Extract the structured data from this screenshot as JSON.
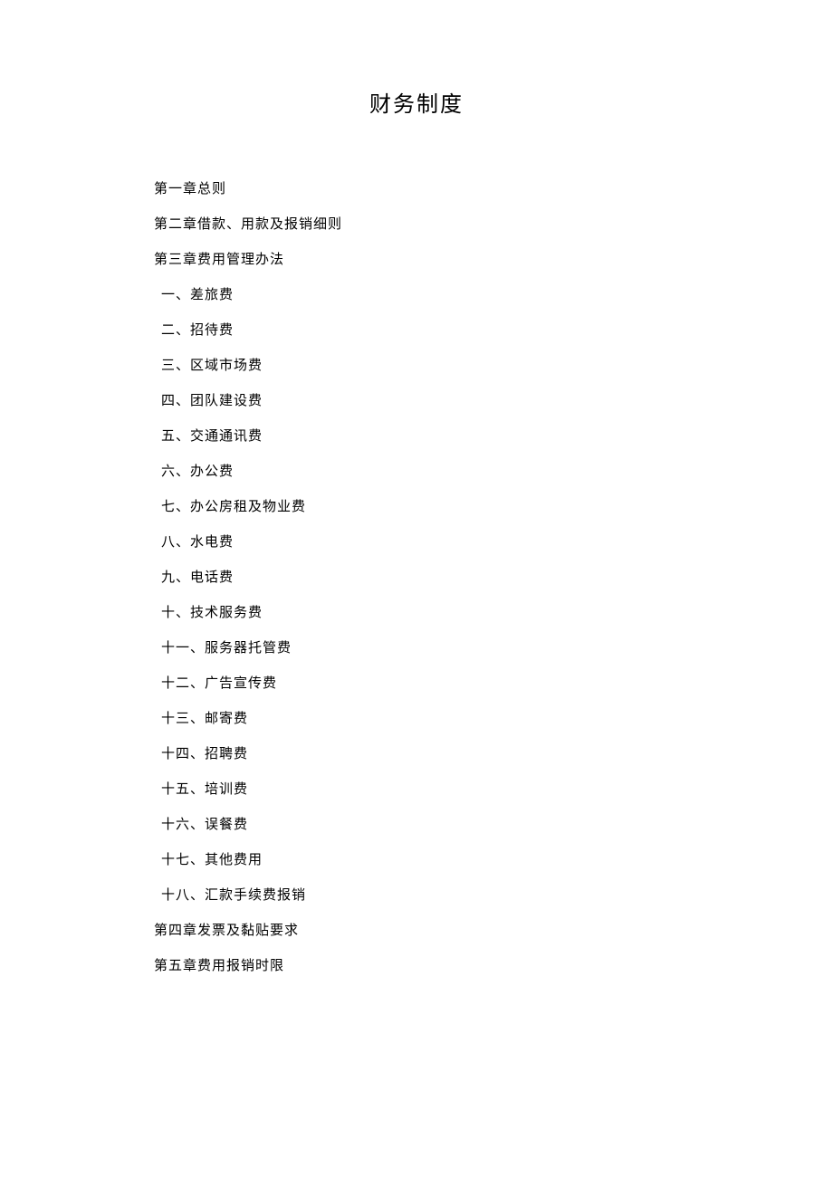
{
  "title": "财务制度",
  "chapters": {
    "ch1": "第一章总则",
    "ch2": "第二章借款、用款及报销细则",
    "ch3": "第三章费用管理办法",
    "ch4": "第四章发票及黏贴要求",
    "ch5": "第五章费用报销时限"
  },
  "items": {
    "i1": "一、差旅费",
    "i2": "二、招待费",
    "i3": "三、区域市场费",
    "i4": "四、团队建设费",
    "i5": "五、交通通讯费",
    "i6": "六、办公费",
    "i7": "七、办公房租及物业费",
    "i8": "八、水电费",
    "i9": "九、电话费",
    "i10": "十、技术服务费",
    "i11": "十一、服务器托管费",
    "i12": "十二、广告宣传费",
    "i13": "十三、邮寄费",
    "i14": "十四、招聘费",
    "i15": "十五、培训费",
    "i16": "十六、误餐费",
    "i17": "十七、其他费用",
    "i18": "十八、汇款手续费报销"
  }
}
